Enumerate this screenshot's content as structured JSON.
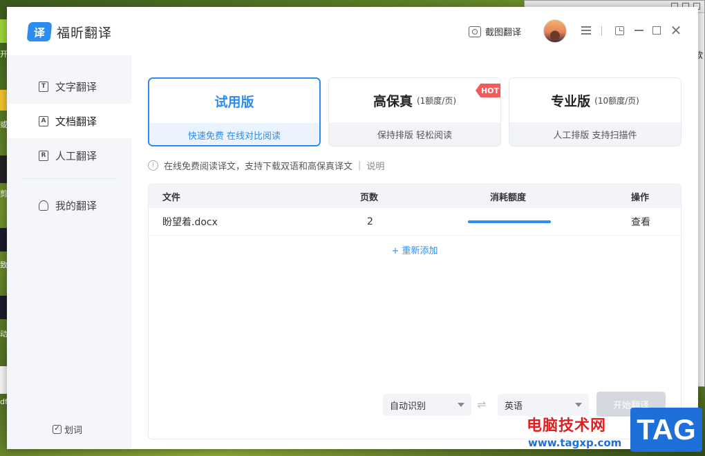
{
  "desktop": {
    "side_texts": [
      "开",
      "或",
      "剪",
      "致",
      "动",
      "df"
    ]
  },
  "background_window": {
    "side_text": "软"
  },
  "app": {
    "logo_glyph": "译",
    "name": "福昕翻译",
    "screenshot_translate": "截图翻译",
    "window_controls": [
      "menu-icon",
      "pin-icon",
      "minimize-icon",
      "maximize-icon",
      "close-icon"
    ],
    "close_glyph": "✕"
  },
  "sidebar": {
    "items": [
      {
        "icon": "T",
        "label": "文字翻译",
        "active": false
      },
      {
        "icon": "A",
        "label": "文档翻译",
        "active": true
      },
      {
        "icon": "R",
        "label": "人工翻译",
        "active": false
      },
      {
        "icon": "person-icon",
        "label": "我的翻译",
        "active": false
      }
    ],
    "hua_ci_check": "✓",
    "hua_ci": "划词"
  },
  "plans": [
    {
      "name": "试用版",
      "sub": "",
      "foot": "快速免费 在线对比阅读",
      "selected": true,
      "hot": ""
    },
    {
      "name": "高保真",
      "sub": "(1额度/页)",
      "foot": "保持排版 轻松阅读",
      "selected": false,
      "hot": "HOT"
    },
    {
      "name": "专业版",
      "sub": "(10额度/页)",
      "foot": "人工排版 支持扫描件",
      "selected": false,
      "hot": ""
    }
  ],
  "notice": {
    "info_glyph": "!",
    "text": "在线免费阅读译文，支持下载双语和高保真译文",
    "pipe": "|",
    "link": "说明"
  },
  "table": {
    "headers": [
      "文件",
      "页数",
      "消耗额度",
      "操作"
    ],
    "rows": [
      {
        "file": "盼望着.docx",
        "pages": "2",
        "usage_fraction": 1.0,
        "action": "查看"
      }
    ],
    "add_again": "+ 重新添加"
  },
  "controls": {
    "source_lang": "自动识别",
    "swap_glyph": "⇌",
    "target_lang": "英语",
    "start_button": "开始翻译"
  },
  "colors": {
    "accent": "#2d8cf0",
    "hot_badge": "#f25b5b",
    "disabled_button": "#d5d8de"
  },
  "watermark": {
    "cn": "电脑技术网",
    "url": "www.tagxp.com",
    "tag": "TAG"
  }
}
